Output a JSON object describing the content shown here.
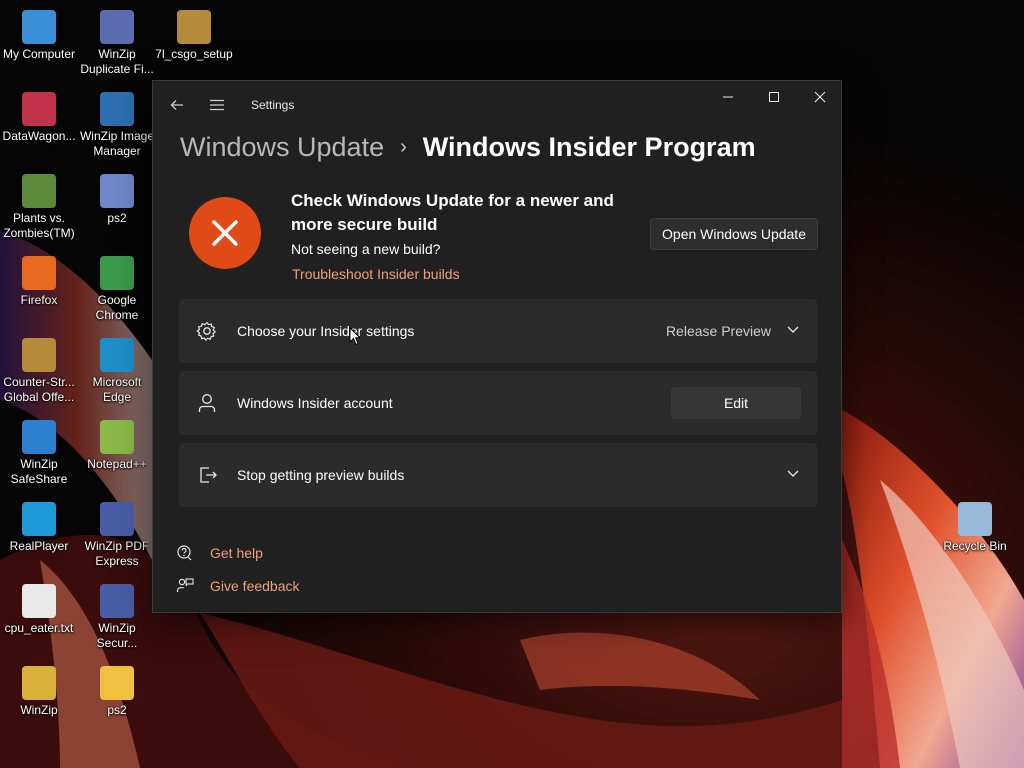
{
  "desktop": {
    "icons": [
      {
        "label": "My Computer",
        "icon": "monitor-icon",
        "color": "#3a8fd8"
      },
      {
        "label": "WinZip\nDuplicate Fi...",
        "icon": "winzip-duplicate-icon",
        "color": "#5a6bb0"
      },
      {
        "label": "7l_csgo_setup",
        "icon": "csgo-setup-icon",
        "color": "#b58a3a"
      },
      {
        "label": "DataWagon...",
        "icon": "datawagon-icon",
        "color": "#c0334a"
      },
      {
        "label": "WinZip Image\nManager",
        "icon": "winzip-image-icon",
        "color": "#2d6fb0"
      },
      {
        "label": "Plants vs.\nZombies(TM)",
        "icon": "plants-vs-zombies-icon",
        "color": "#5c8a3a"
      },
      {
        "label": "ps2",
        "icon": "ps2-icon",
        "color": "#6f86c8"
      },
      {
        "label": "Firefox",
        "icon": "firefox-icon",
        "color": "#e86a1f"
      },
      {
        "label": "Google\nChrome",
        "icon": "chrome-icon",
        "color": "#3a9a4a"
      },
      {
        "label": "Counter-Str...\nGlobal Offe...",
        "icon": "counter-strike-icon",
        "color": "#b58a3a"
      },
      {
        "label": "Microsoft\nEdge",
        "icon": "edge-icon",
        "color": "#1f8fc8"
      },
      {
        "label": "WinZip\nSafeShare",
        "icon": "winzip-safeshare-icon",
        "color": "#2d7fd0"
      },
      {
        "label": "Notepad++",
        "icon": "notepad-plus-icon",
        "color": "#8ab84a"
      },
      {
        "label": "RealPlayer",
        "icon": "realplayer-icon",
        "color": "#1f9ad8"
      },
      {
        "label": "WinZip PDF\nExpress",
        "icon": "winzip-pdf-icon",
        "color": "#4a5ea8"
      },
      {
        "label": "cpu_eater.txt",
        "icon": "text-file-icon",
        "color": "#e8e8e8"
      },
      {
        "label": "WinZip\nSecur...",
        "icon": "winzip-secure-icon",
        "color": "#4a5ea8"
      },
      {
        "label": "WinZip",
        "icon": "winzip-icon",
        "color": "#d8b03a"
      },
      {
        "label": "ps2",
        "icon": "folder-icon",
        "color": "#f0c040"
      },
      {
        "label": "Recycle Bin",
        "icon": "recycle-bin-icon",
        "color": "#9ab8d8"
      }
    ]
  },
  "window": {
    "title": "Settings",
    "breadcrumb": {
      "parent": "Windows Update",
      "separator": "›",
      "current": "Windows Insider Program"
    },
    "warning": {
      "heading": "Check Windows Update for a newer and more secure build",
      "subtext": "Not seeing a new build?",
      "link": "Troubleshoot Insider builds",
      "button": "Open Windows Update"
    },
    "cards": {
      "insider_settings": {
        "label": "Choose your Insider settings",
        "value": "Release Preview"
      },
      "insider_account": {
        "label": "Windows Insider account",
        "button": "Edit"
      },
      "stop_builds": {
        "label": "Stop getting preview builds"
      }
    },
    "help": {
      "get_help": "Get help",
      "give_feedback": "Give feedback"
    }
  },
  "colors": {
    "accent": "#f0a07a",
    "warning": "#e04a16",
    "window_bg": "#202020",
    "card_bg": "#2b2b2b"
  }
}
